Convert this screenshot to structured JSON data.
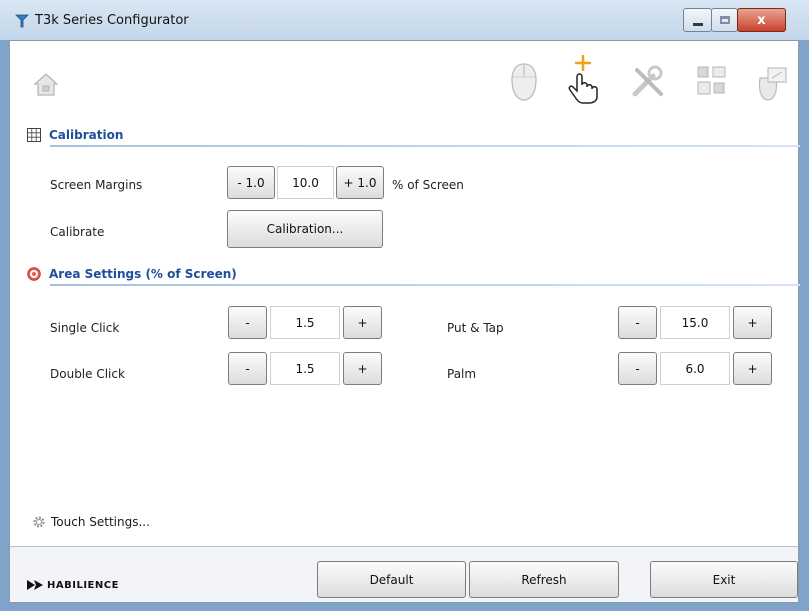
{
  "window": {
    "title": "T3k Series Configurator",
    "close_glyph": "x"
  },
  "toolbar": {
    "icons": [
      "home-icon",
      "mouse-icon",
      "touch-pointer-icon",
      "tools-icon",
      "network-icon",
      "hardware-icon"
    ]
  },
  "calibration": {
    "title": "Calibration",
    "screen_margins_label": "Screen Margins",
    "minus_label": "- 1.0",
    "value": "10.0",
    "plus_label": "+ 1.0",
    "unit": "% of Screen",
    "calibrate_label": "Calibrate",
    "calibration_button": "Calibration..."
  },
  "area": {
    "title": "Area Settings (% of Screen)",
    "minus": "-",
    "plus": "+",
    "single_click": {
      "label": "Single Click",
      "value": "1.5"
    },
    "double_click": {
      "label": "Double Click",
      "value": "1.5"
    },
    "put_tap": {
      "label": "Put & Tap",
      "value": "15.0"
    },
    "palm": {
      "label": "Palm",
      "value": "6.0"
    }
  },
  "touch_settings": "Touch Settings...",
  "footer": {
    "logo_text": "HABILIENCE",
    "default_button": "Default",
    "refresh_button": "Refresh",
    "exit_button": "Exit"
  },
  "colors": {
    "accent": "#1f4e9a",
    "close": "#c9432c",
    "section_line": "#a7c1e4"
  }
}
